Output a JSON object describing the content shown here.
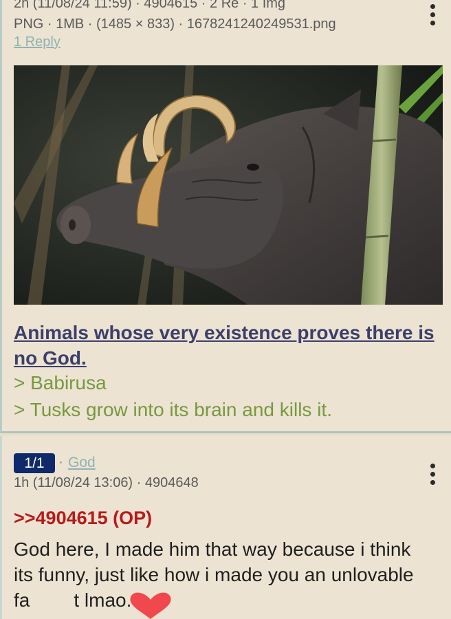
{
  "op": {
    "meta_line1": "2h (11/08/24 11:59) · 4904615 · 2 Re · 1 Img",
    "meta_line2": "PNG · 1MB · (1485 × 833) · 1678241240249531.png",
    "reply_link": "1 Reply",
    "image_icon": "babirusa-photo",
    "subject": "Animals whose very existence proves there is no God.",
    "greentext": [
      "> Babirusa",
      "> Tusks grow into its brain and kills it."
    ],
    "menu_icon": "kebab-menu-icon"
  },
  "reply": {
    "id_badge": "1/1",
    "separator": "·",
    "name": "God",
    "meta": "1h (11/08/24 13:06) · 4904648",
    "quote_link": ">>4904615 (OP)",
    "body_before": "God here, I made him that way because i think its funny, just like how i made you an unlovable fa",
    "body_after": "t lmao.",
    "censor_icon": "heart-emoji-icon",
    "censor_color": "#f0484d",
    "menu_icon": "kebab-menu-icon"
  },
  "colors": {
    "background": "#ece3d2",
    "subject": "#3d3f6b",
    "greentext": "#78993f",
    "quote_link": "#b81a1a",
    "id_badge": "#0f2a6b",
    "name": "#8fb3b3"
  }
}
